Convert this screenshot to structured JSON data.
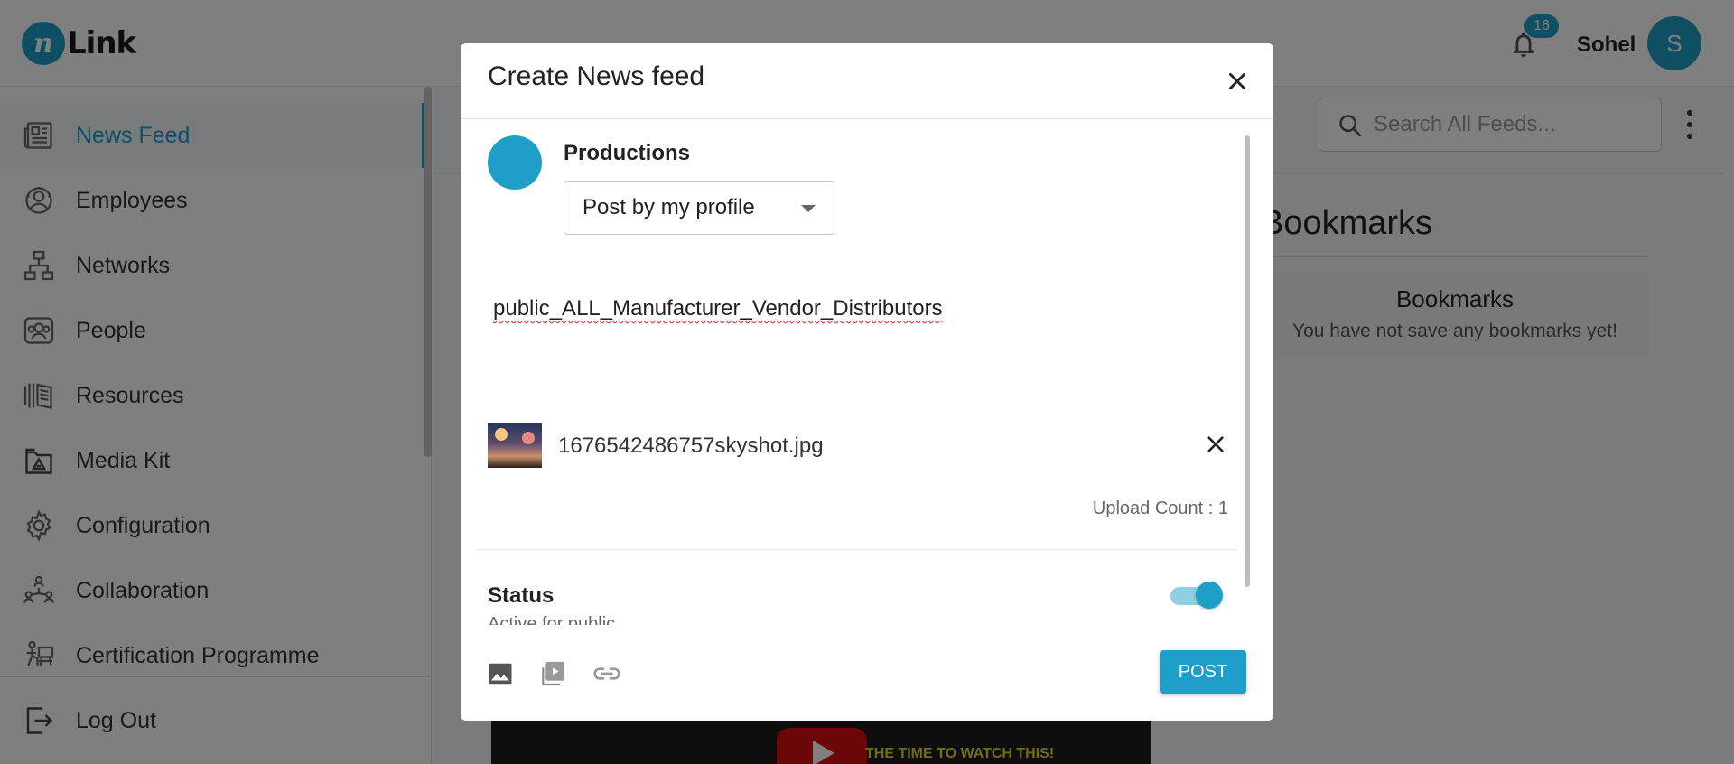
{
  "app": {
    "logo_letter": "n",
    "logo_text": "Link"
  },
  "header": {
    "notification_count": "16",
    "user_name": "Sohel",
    "user_initial": "S"
  },
  "sidebar": {
    "items": [
      {
        "label": "News Feed",
        "icon": "newspaper-icon",
        "active": true
      },
      {
        "label": "Employees",
        "icon": "employees-icon",
        "active": false
      },
      {
        "label": "Networks",
        "icon": "network-icon",
        "active": false
      },
      {
        "label": "People",
        "icon": "people-icon",
        "active": false
      },
      {
        "label": "Resources",
        "icon": "book-icon",
        "active": false
      },
      {
        "label": "Media Kit",
        "icon": "media-kit-icon",
        "active": false
      },
      {
        "label": "Configuration",
        "icon": "gear-icon",
        "active": false
      },
      {
        "label": "Collaboration",
        "icon": "collaboration-icon",
        "active": false
      },
      {
        "label": "Certification Programme",
        "icon": "certification-icon",
        "active": false
      },
      {
        "label": "Log Out",
        "icon": "logout-icon",
        "active": false
      }
    ]
  },
  "content": {
    "search_placeholder": "Search All Feeds...",
    "bookmarks_heading": "Bookmarks",
    "bookmarks_card_title": "Bookmarks",
    "bookmarks_card_text": "You have not save any bookmarks yet!",
    "video_caption": "THE TIME TO WATCH THIS!"
  },
  "modal": {
    "title": "Create News feed",
    "profile_name": "Productions",
    "post_by_selected": "Post by my profile",
    "post_text": "public_ALL_Manufacturer_Vendor_Distributors",
    "attachment_name": "1676542486757skyshot.jpg",
    "upload_count": "Upload Count : 1",
    "status_label": "Status",
    "status_sub": "Active for public",
    "status_active": true,
    "post_button": "POST"
  },
  "colors": {
    "accent": "#1f9fc7",
    "overlay": "rgba(0,0,0,0.5)"
  }
}
